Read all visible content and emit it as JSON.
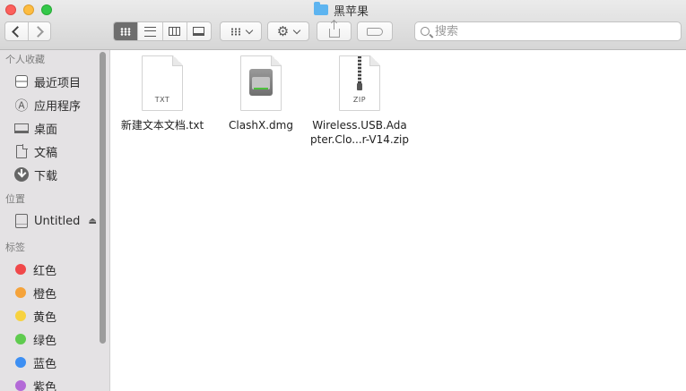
{
  "window": {
    "title": "黑苹果",
    "title_icon": "folder-icon"
  },
  "toolbar": {
    "back": "chevron-left-icon",
    "forward": "chevron-right-icon",
    "view_modes": [
      "icon-view",
      "list-view",
      "column-view",
      "cover-flow-view"
    ],
    "active_view": "icon-view",
    "search_placeholder": "搜索"
  },
  "sidebar": {
    "favorites_header": "个人收藏",
    "favorites": [
      {
        "label": "最近项目",
        "icon": "recents-icon"
      },
      {
        "label": "应用程序",
        "icon": "applications-icon"
      },
      {
        "label": "桌面",
        "icon": "desktop-icon"
      },
      {
        "label": "文稿",
        "icon": "documents-icon"
      },
      {
        "label": "下载",
        "icon": "downloads-icon"
      }
    ],
    "locations_header": "位置",
    "locations": [
      {
        "label": "Untitled",
        "icon": "drive-icon"
      }
    ],
    "tags_header": "标签",
    "tags": [
      {
        "label": "红色",
        "color": "#f0484a"
      },
      {
        "label": "橙色",
        "color": "#f5a33a"
      },
      {
        "label": "黄色",
        "color": "#f7d23f"
      },
      {
        "label": "绿色",
        "color": "#5fcb4f"
      },
      {
        "label": "蓝色",
        "color": "#3d8ff3"
      },
      {
        "label": "紫色",
        "color": "#b36ad7"
      }
    ]
  },
  "files": [
    {
      "name": "新建文本文档.txt",
      "type_label": "TXT",
      "icon": "text-document-icon"
    },
    {
      "name": "ClashX.dmg",
      "type_label": "",
      "icon": "disk-image-icon"
    },
    {
      "name": "Wireless.USB.Adapter.Clo...r-V14.zip",
      "type_label": "ZIP",
      "icon": "zip-archive-icon"
    }
  ]
}
